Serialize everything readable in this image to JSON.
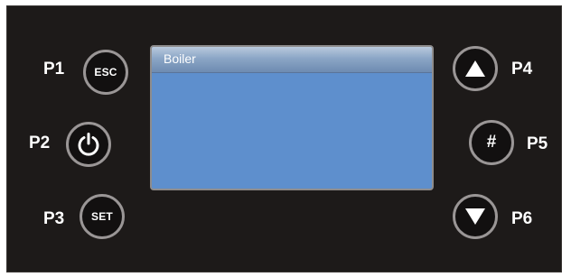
{
  "screen": {
    "title": "Boiler"
  },
  "buttons": {
    "p1": {
      "label": "P1",
      "text": "ESC"
    },
    "p2": {
      "label": "P2",
      "icon": "power-icon"
    },
    "p3": {
      "label": "P3",
      "text": "SET"
    },
    "p4": {
      "label": "P4",
      "icon": "arrow-up-icon"
    },
    "p5": {
      "label": "P5",
      "text": "#"
    },
    "p6": {
      "label": "P6",
      "icon": "arrow-down-icon"
    }
  },
  "colors": {
    "panel": "#1d1a19",
    "screen": "#5e8fcd",
    "button_ring": "#9a9696",
    "text": "#ffffff"
  }
}
